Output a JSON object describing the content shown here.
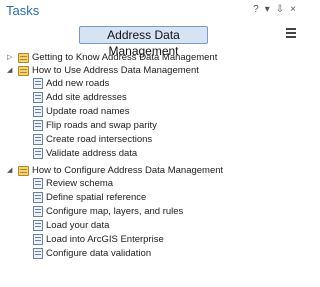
{
  "pane": {
    "title": "Tasks",
    "controls": [
      "?",
      "▾",
      "⇩",
      "×"
    ]
  },
  "task_item": {
    "name": "Address Data Management"
  },
  "groups": [
    {
      "label": "Getting to Know Address Data Management",
      "expanded": false,
      "tasks": []
    },
    {
      "label": "How to Use Address Data Management",
      "expanded": true,
      "tasks": [
        "Add new roads",
        "Add site addresses",
        "Update road names",
        "Flip roads and swap parity",
        "Create road intersections",
        "Validate address data"
      ]
    },
    {
      "label": "How to Configure Address Data Management",
      "expanded": true,
      "tasks": [
        "Review schema",
        "Define spatial reference",
        "Configure map, layers, and rules",
        "Load your data",
        "Load into ArcGIS Enterprise",
        "Configure data validation"
      ]
    }
  ]
}
